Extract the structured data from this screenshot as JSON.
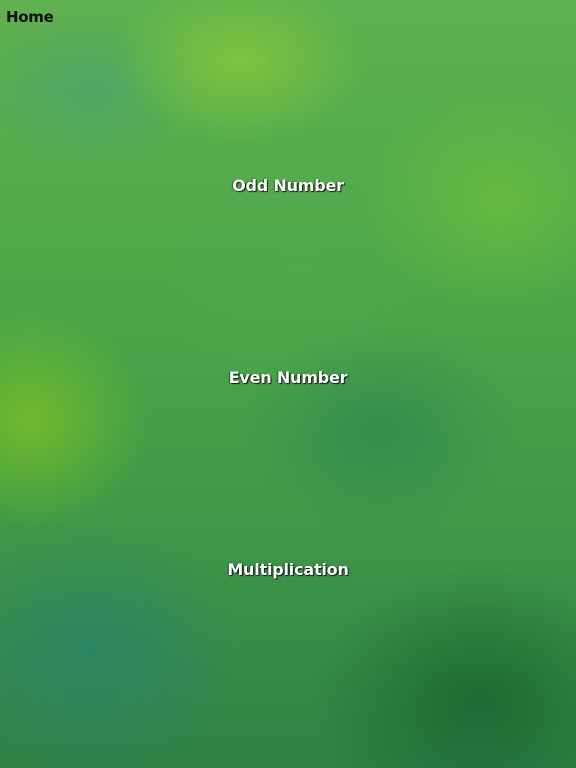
{
  "nav": {
    "home_label": "Home"
  },
  "menu": {
    "items": [
      {
        "label": "Odd Number"
      },
      {
        "label": "Even Number"
      },
      {
        "label": "Multiplication"
      }
    ]
  },
  "colors": {
    "background": "#4ea84a",
    "menu_text": "#ffffff",
    "home_text": "#111111"
  }
}
